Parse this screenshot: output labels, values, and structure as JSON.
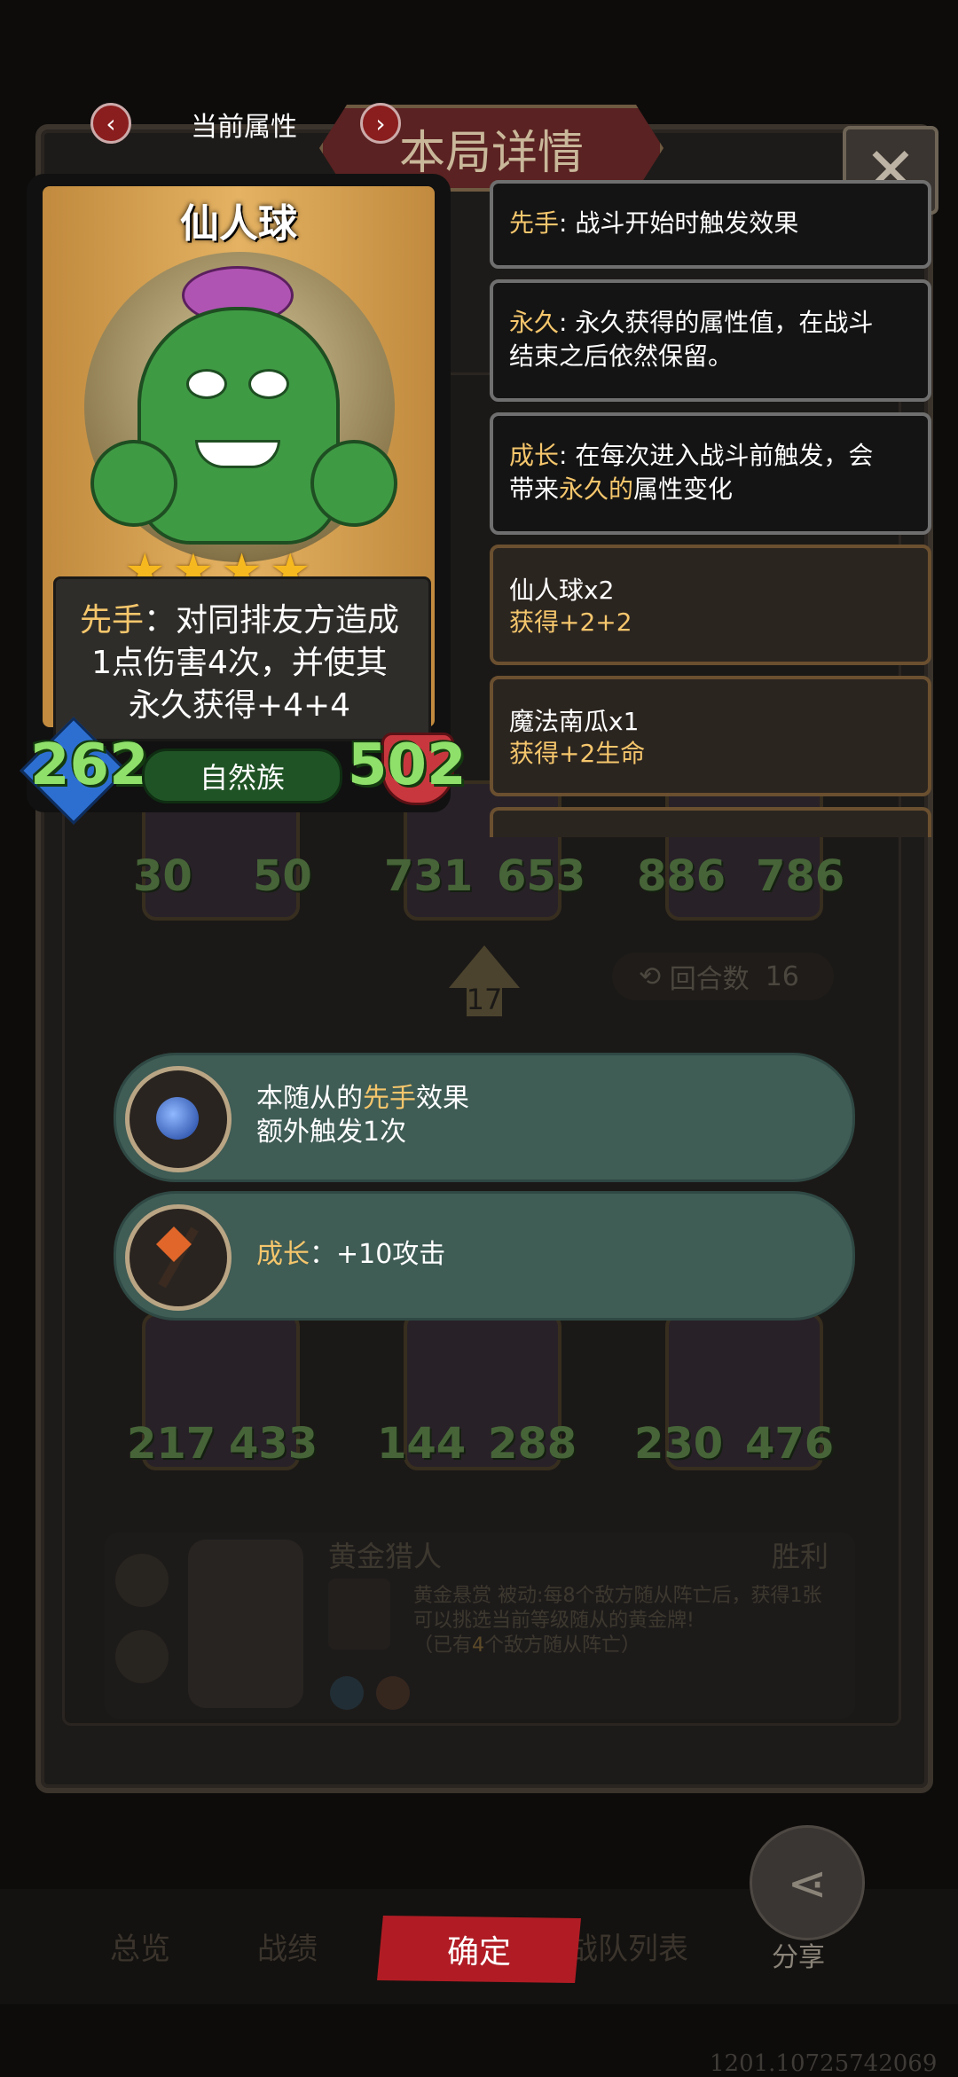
{
  "header": {
    "current_attr_label": "当前属性",
    "panel_title": "本局详情",
    "close_glyph": "✕",
    "prev_glyph": "‹",
    "next_glyph": "›"
  },
  "card": {
    "name": "仙人球",
    "stars": 4,
    "star_glyph": "★★★★",
    "desc_keyword": "先手",
    "desc_line1_rest": "：对同排友方造成",
    "desc_line2": "1点伤害4次，并使其",
    "desc_line3": "永久获得+4+4",
    "attack": "262",
    "health": "502",
    "tribe": "自然族"
  },
  "keywords": [
    {
      "kw": "先手",
      "text": ": 战斗开始时触发效果"
    },
    {
      "kw": "永久",
      "text": ": 永久获得的属性值，在战斗",
      "text2": "结束之后依然保留。"
    },
    {
      "kw": "成长",
      "text": ": 在每次进入战斗前触发，会",
      "text2_pre": "带来",
      "text2_kw": "永久的",
      "text2_post": "属性变化"
    }
  ],
  "bonuses": [
    {
      "title": "仙人球x2",
      "detail": "获得+2+2"
    },
    {
      "title": "魔法南瓜x1",
      "detail": "获得+2生命"
    }
  ],
  "board": {
    "row1_stats": [
      [
        "30",
        "50"
      ],
      [
        "731",
        "653"
      ],
      [
        "886",
        "786"
      ]
    ],
    "turn_number": "17",
    "round_label": "回合数",
    "round_value": "16",
    "row3_stats": [
      [
        "217",
        "433"
      ],
      [
        "144",
        "288"
      ],
      [
        "230",
        "476"
      ]
    ]
  },
  "popups": [
    {
      "pre": "本随从的",
      "kw": "先手",
      "post": "效果",
      "line2": "额外触发1次"
    },
    {
      "kw": "成长",
      "post": "：+10攻击"
    }
  ],
  "hero": {
    "name": "黄金猎人",
    "result": "胜利",
    "skill_name": "黄金悬赏",
    "skill_type": "被动",
    "desc": ":每8个敌方随从阵亡后，获得1张可以挑选当前等级随从的黄金牌!",
    "progress_pre": "（已有",
    "progress_num": "4",
    "progress_post": "个敌方随从阵亡）"
  },
  "bottom": {
    "tabs": [
      "总览",
      "战绩",
      "战队列表"
    ],
    "confirm": "确定",
    "share": "分享",
    "footer_id": "1201.10725742069"
  },
  "colors": {
    "keyword": "#f5c66c",
    "stat_green": "#8fe06a",
    "confirm_red": "#b11c24",
    "popup_teal": "#3f5c55"
  }
}
